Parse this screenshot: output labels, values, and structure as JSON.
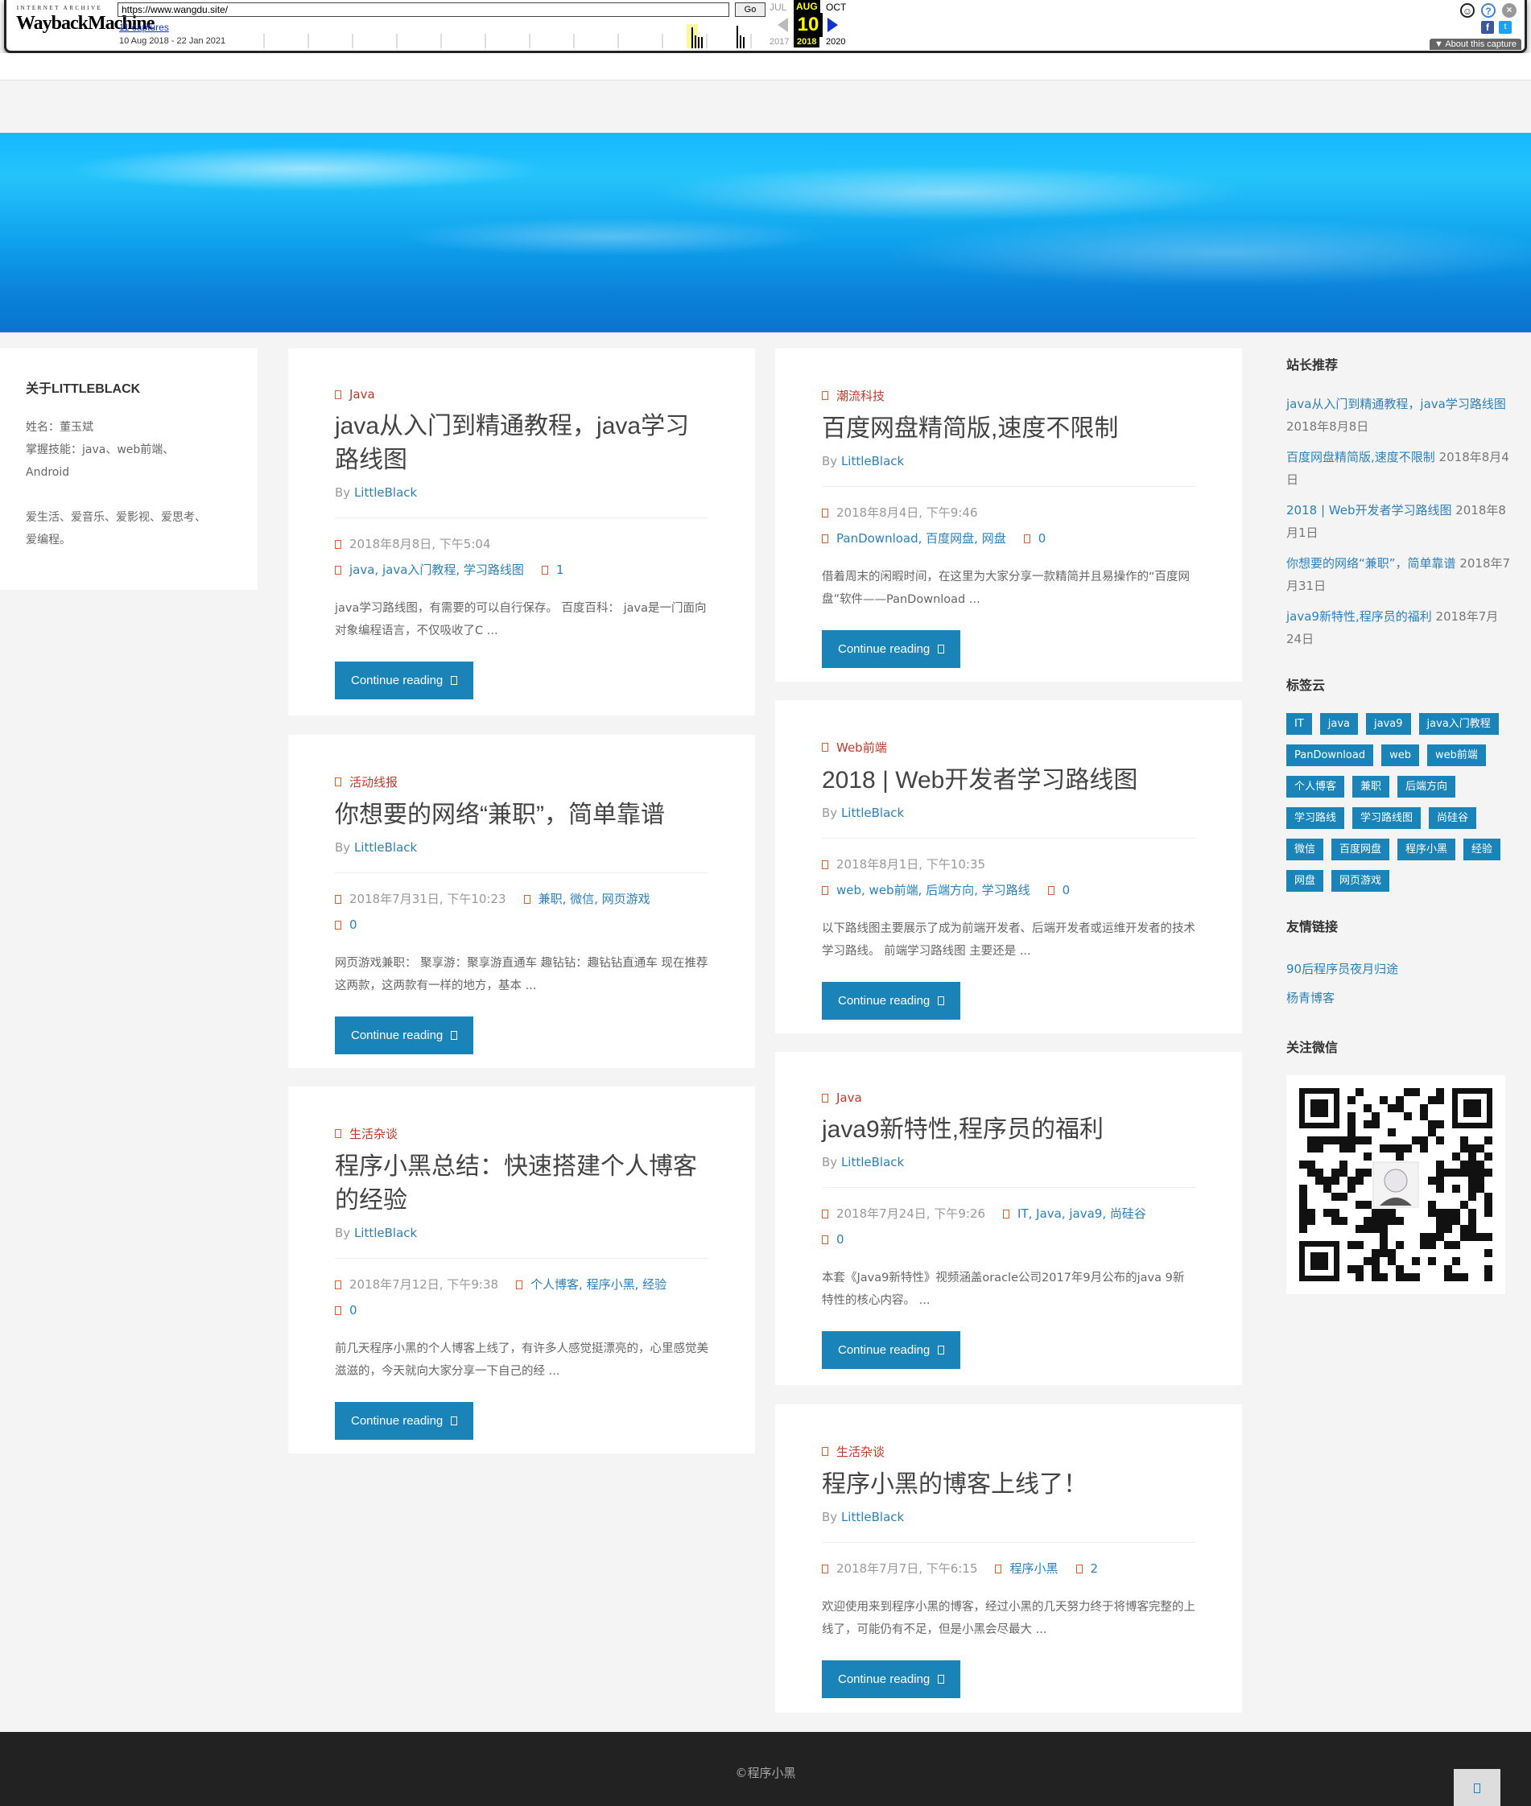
{
  "wayback": {
    "logo_top": "INTERNET ARCHIVE",
    "logo_main": "WaybackMachine",
    "url": "https://www.wangdu.site/",
    "go_label": "Go",
    "captures": "11 captures",
    "range": "10 Aug 2018 - 22 Jan 2021",
    "month_prev": "JUL",
    "month_cur": "AUG",
    "month_next": "OCT",
    "day": "10",
    "year_prev": "2017",
    "year_cur": "2018",
    "year_next": "2020",
    "about": "▼ About this capture"
  },
  "about_widget": {
    "title": "关于LITTLEBLACK",
    "line1": "姓名：董玉斌",
    "line2": "掌握技能：java、web前端、",
    "line3": "Android",
    "line4": "爱生活、爱音乐、爱影视、爱思考、",
    "line5": "爱编程。"
  },
  "posts_left": [
    {
      "category": "Java",
      "title": "java从入门到精通教程，java学习路线图",
      "by": "By",
      "author": "LittleBlack",
      "date": "2018年8月8日, 下午5:04",
      "tags": "java, java入门教程, 学习路线图",
      "comments": "1",
      "excerpt": "java学习路线图，有需要的可以自行保存。 百度百科： java是一门面向对象编程语言，不仅吸收了C ...",
      "button": "Continue reading"
    },
    {
      "category": "活动线报",
      "title": "你想要的网络“兼职”，简单靠谱",
      "by": "By",
      "author": "LittleBlack",
      "date": "2018年7月31日, 下午10:23",
      "tags": "兼职, 微信, 网页游戏",
      "comments": "0",
      "excerpt": "网页游戏兼职： 聚享游：聚享游直通车 趣钻钻：趣钻钻直通车 现在推荐这两款，这两款有一样的地方，基本 ...",
      "button": "Continue reading"
    },
    {
      "category": "生活杂谈",
      "title": "程序小黑总结：快速搭建个人博客的经验",
      "by": "By",
      "author": "LittleBlack",
      "date": "2018年7月12日, 下午9:38",
      "tags": "个人博客, 程序小黑, 经验",
      "comments": "0",
      "excerpt": "前几天程序小黑的个人博客上线了，有许多人感觉挺漂亮的，心里感觉美滋滋的，今天就向大家分享一下自己的经 ...",
      "button": "Continue reading"
    }
  ],
  "posts_right": [
    {
      "category": "潮流科技",
      "title": "百度网盘精简版,速度不限制",
      "by": "By",
      "author": "LittleBlack",
      "date": "2018年8月4日, 下午9:46",
      "tags": "PanDownload, 百度网盘, 网盘",
      "comments": "0",
      "excerpt": "借着周末的闲暇时间，在这里为大家分享一款精简并且易操作的“百度网盘”软件——PanDownload ...",
      "button": "Continue reading"
    },
    {
      "category": "Web前端",
      "title": "2018 | Web开发者学习路线图",
      "by": "By",
      "author": "LittleBlack",
      "date": "2018年8月1日, 下午10:35",
      "tags": "web, web前端, 后端方向, 学习路线",
      "comments": "0",
      "excerpt": "以下路线图主要展示了成为前端开发者、后端开发者或运维开发者的技术学习路线。 前端学习路线图 主要还是 ...",
      "button": "Continue reading"
    },
    {
      "category": "Java",
      "title": "java9新特性,程序员的福利",
      "by": "By",
      "author": "LittleBlack",
      "date": "2018年7月24日, 下午9:26",
      "tags": "IT, Java, java9, 尚硅谷",
      "comments": "0",
      "excerpt": "本套《Java9新特性》视频涵盖oracle公司2017年9月公布的java 9新特性的核心内容。 ...",
      "button": "Continue reading"
    },
    {
      "category": "生活杂谈",
      "title": "程序小黑的博客上线了！",
      "by": "By",
      "author": "LittleBlack",
      "date": "2018年7月7日, 下午6:15",
      "tags": "程序小黑",
      "comments": "2",
      "excerpt": "欢迎使用来到程序小黑的博客，经过小黑的几天努力终于将博客完整的上线了，可能仍有不足，但是小黑会尽最大 ...",
      "button": "Continue reading"
    }
  ],
  "sidebar": {
    "rec_title": "站长推荐",
    "recommended": [
      {
        "title": "java从入门到精通教程，java学习路线图",
        "date": "2018年8月8日"
      },
      {
        "title": "百度网盘精简版,速度不限制",
        "date": "2018年8月4日"
      },
      {
        "title": "2018 | Web开发者学习路线图",
        "date": "2018年8月1日"
      },
      {
        "title": "你想要的网络“兼职”，简单靠谱",
        "date": "2018年7月31日"
      },
      {
        "title": "java9新特性,程序员的福利",
        "date": "2018年7月24日"
      }
    ],
    "tags_title": "标签云",
    "tags": [
      "IT",
      "java",
      "java9",
      "java入门教程",
      "PanDownload",
      "web",
      "web前端",
      "个人博客",
      "兼职",
      "后端方向",
      "学习路线",
      "学习路线图",
      "尚硅谷",
      "微信",
      "百度网盘",
      "程序小黑",
      "经验",
      "网盘",
      "网页游戏"
    ],
    "links_title": "友情链接",
    "links": [
      "90后程序员夜月归途",
      "杨青博客"
    ],
    "wechat_title": "关注微信"
  },
  "footer": {
    "copyright": "©程序小黑"
  },
  "colors": {
    "accent": "#1a84b8",
    "link": "#2b80b9",
    "category": "#c0392b",
    "footer_bg": "#222222"
  }
}
